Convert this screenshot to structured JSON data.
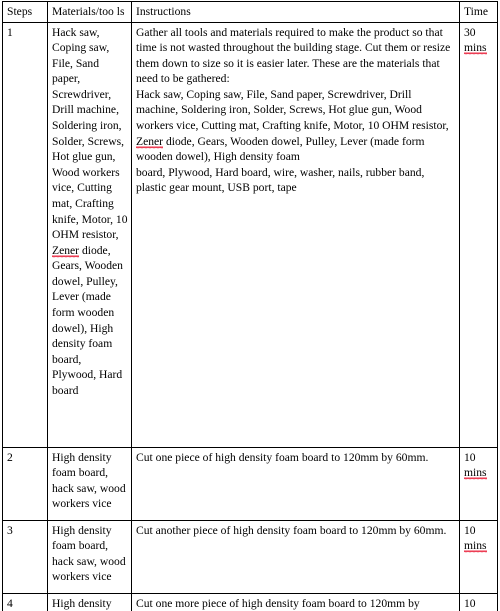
{
  "document": {
    "type": "table",
    "columns": [
      "Steps",
      "Materials/tools",
      "Instructions",
      "Time"
    ],
    "headers": {
      "steps": "Steps",
      "materials": "Materials/too ls",
      "instructions": "Instructions",
      "time": "Time"
    },
    "rows": [
      {
        "step": "1",
        "materials_part1": "Hack saw, Coping saw, File, Sand paper, Screwdriver, Drill machine, Soldering iron, Solder, Screws, Hot glue gun, Wood workers vice, Cutting mat, Crafting knife, Motor, 10 OHM resistor, ",
        "materials_misspelled": "Zener",
        "materials_part2": " diode, Gears, Wooden dowel, Pulley, Lever (made form wooden dowel), High density foam board, Plywood, Hard board",
        "instructions_para1": "Gather all tools and materials required to make the product so that time is not wasted throughout the building stage. Cut them or resize them down to size so it is easier later. These are the materials that need to be gathered:",
        "instructions_para2_part1": "Hack saw, Coping saw, File, Sand paper, Screwdriver, Drill machine, Soldering iron, Solder, Screws, Hot glue gun, Wood workers vice, Cutting mat, Crafting knife, Motor, 10 OHM resistor, ",
        "instructions_misspelled": "Zener",
        "instructions_para2_part2": " diode, Gears, Wooden dowel, Pulley, Lever (made form wooden dowel), High density foam",
        "instructions_para3": "board, Plywood, Hard board, wire, washer, nails, rubber band, plastic gear mount, USB port, tape",
        "time_value": "30",
        "time_unit": "mins"
      },
      {
        "step": "2",
        "materials": "High density foam board, hack saw, wood workers vice",
        "instructions": "Cut one piece of high density foam board to 120mm by 60mm.",
        "time_value": "10",
        "time_unit": "mins"
      },
      {
        "step": "3",
        "materials": "High density foam board, hack saw, wood workers vice",
        "instructions": "Cut another piece of high density foam board to 120mm by 60mm.",
        "time_value": "10",
        "time_unit": "mins"
      },
      {
        "step": "4",
        "materials": "High density",
        "instructions": "Cut one more piece of high density foam board to 120mm by",
        "time_value": "10",
        "time_unit": ""
      }
    ]
  },
  "colors": {
    "text": "#000000",
    "border": "#000000",
    "spellcheck_underline": "#e8112d",
    "background": "#ffffff"
  }
}
